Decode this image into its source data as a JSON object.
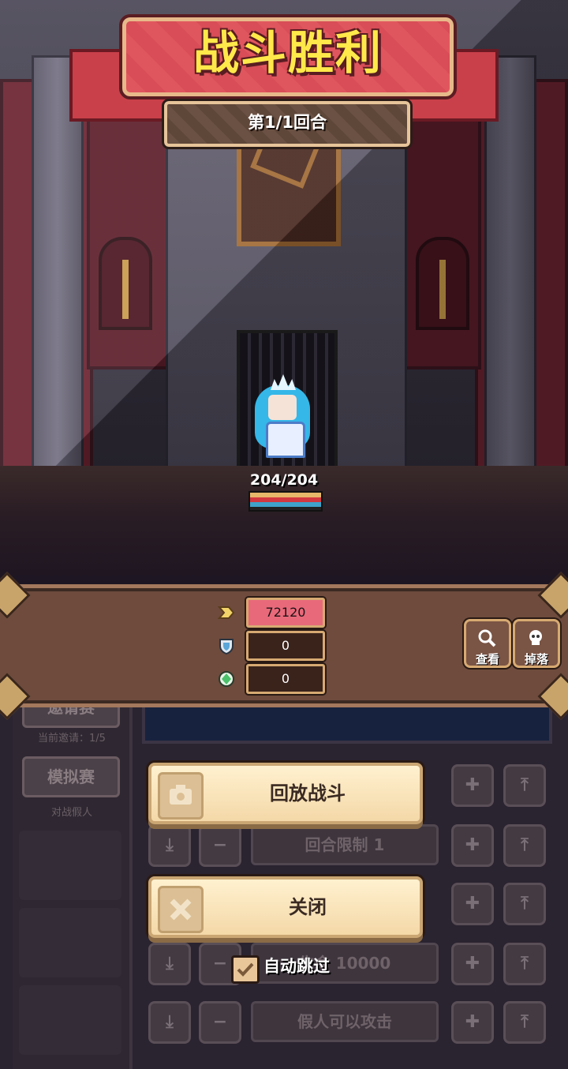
{
  "banner": {
    "title": "战斗胜利",
    "round": "第1/1回合"
  },
  "hero": {
    "hp_text": "204/204",
    "hp_fraction": 1.0
  },
  "rewards": {
    "gold": {
      "icon": "gold-arrow-icon",
      "value": "72120"
    },
    "shield": {
      "icon": "shield-icon",
      "value": "0"
    },
    "gem": {
      "icon": "green-gem-icon",
      "value": "0"
    }
  },
  "actions": {
    "view_label": "查看",
    "drop_label": "掉落",
    "replay_label": "回放战斗",
    "close_label": "关闭",
    "auto_skip_label": "自动跳过",
    "auto_skip_checked": true
  },
  "background_ui": {
    "invite_label": "邀请赛",
    "current_invite": "当前邀请：1/5",
    "sim_label": "模拟赛",
    "sim_sub": "对战假人",
    "round_limit": "回合限制 1",
    "hp_field": "生命 10000",
    "dummy_attack": "假人可以攻击"
  },
  "colors": {
    "title_text": "#ffe94a",
    "title_plate": "#d84d57",
    "panel": "#6e4b3d",
    "gold_box": "#e86a7a",
    "button": "#f4d8a8"
  }
}
